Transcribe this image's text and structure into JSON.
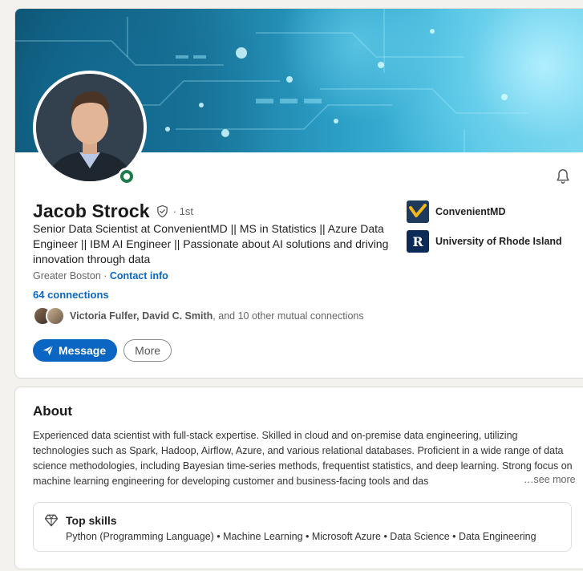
{
  "profile": {
    "name": "Jacob Strock",
    "degree": "· 1st",
    "headline": "Senior Data Scientist at ConvenientMD || MS in Statistics || Azure Data Engineer || IBM AI Engineer || Passionate about AI solutions and driving innovation through data",
    "location": "Greater Boston · ",
    "contact_info": "Contact info",
    "connections": "64 connections",
    "mutual_names": "Victoria Fulfer, David C. Smith",
    "mutual_rest": ", and 10 other mutual connections",
    "message_label": "Message",
    "more_label": "More",
    "organizations": [
      {
        "name": "ConvenientMD",
        "icon": "convenientmd-logo"
      },
      {
        "name": "University of Rhode Island",
        "icon": "uri-logo",
        "logo_letter": "R"
      }
    ]
  },
  "about": {
    "title": "About",
    "text": "Experienced data scientist with full-stack expertise. Skilled in cloud and on-premise data engineering, utilizing technologies such as Spark, Hadoop, Airflow, Azure, and various relational databases. Proficient in a wide range of data science methodologies, including Bayesian time-series methods, frequentist statistics, and deep learning. Strong focus on machine learning engineering for developing customer and business-facing tools and das",
    "see_more": "…see more",
    "top_skills_title": "Top skills",
    "top_skills": "Python (Programming Language) • Machine Learning • Microsoft Azure • Data Science • Data Engineering"
  },
  "colors": {
    "accent": "#0a66c2",
    "online": "#1d7a4a"
  }
}
